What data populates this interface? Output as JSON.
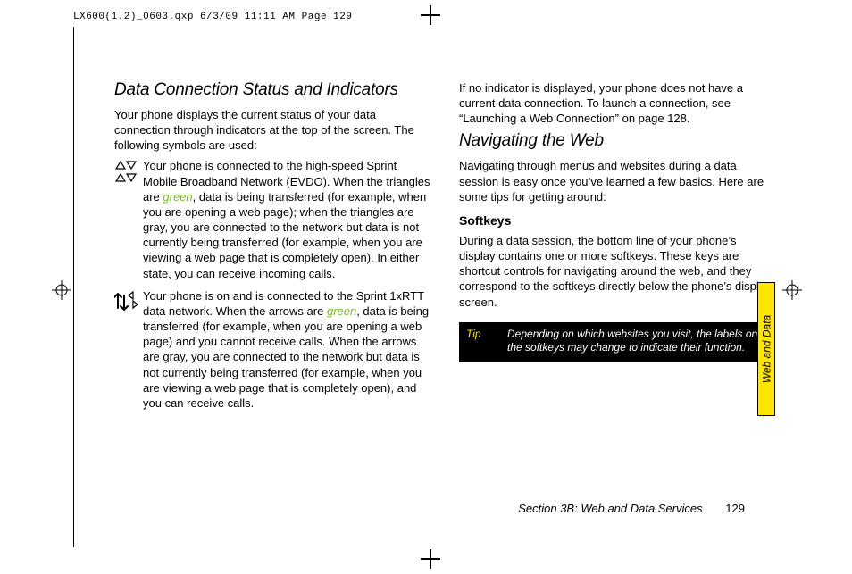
{
  "header": {
    "line": "LX600(1.2)_0603.qxp  6/3/09  11:11 AM  Page 129"
  },
  "sidetab": {
    "label": "Web and Data"
  },
  "left": {
    "h2": "Data Connection Status and Indicators",
    "intro": "Your phone displays the current status of your data connection through indicators at the top of the screen. The following symbols are used:",
    "ind1_a": "Your phone is connected to the high-speed Sprint Mobile Broadband Network (EVDO). When the triangles are ",
    "ind1_green": "green",
    "ind1_b": ", data is being transferred (for example, when you are opening a web page); when the triangles are gray, you are connected to the network but data is not currently being transferred (for example, when you are viewing a web page that is completely open). In either state, you can receive incoming calls.",
    "ind2_a": "Your phone is on and is connected to the Sprint 1xRTT data network. When the arrows are ",
    "ind2_green": "green",
    "ind2_b": ", data is being transferred (for example, when you are opening a web page) and you cannot receive calls. When the arrows are gray, you are connected to the network but data is not currently being transferred (for example, when you are viewing a web page that is completely open), and you can receive calls."
  },
  "right": {
    "no_indicator": "If no indicator is displayed, your phone does not have a current data connection. To launch a connection, see “Launching a Web Connection” on page 128.",
    "h2": "Navigating the Web",
    "nav_intro": "Navigating through menus and websites during a data session is easy once you’ve learned a few basics. Here are some tips for getting around:",
    "h3": "Softkeys",
    "softkeys_body": "During a data session, the bottom line of your phone’s display contains one or more softkeys. These keys are shortcut controls for navigating around the web, and they correspond to the softkeys directly below the phone’s display screen.",
    "tip_label": "Tip",
    "tip_text": "Depending on which websites you visit, the labels on the softkeys may change to indicate their function."
  },
  "footer": {
    "section": "Section 3B: Web and Data Services",
    "page": "129"
  }
}
